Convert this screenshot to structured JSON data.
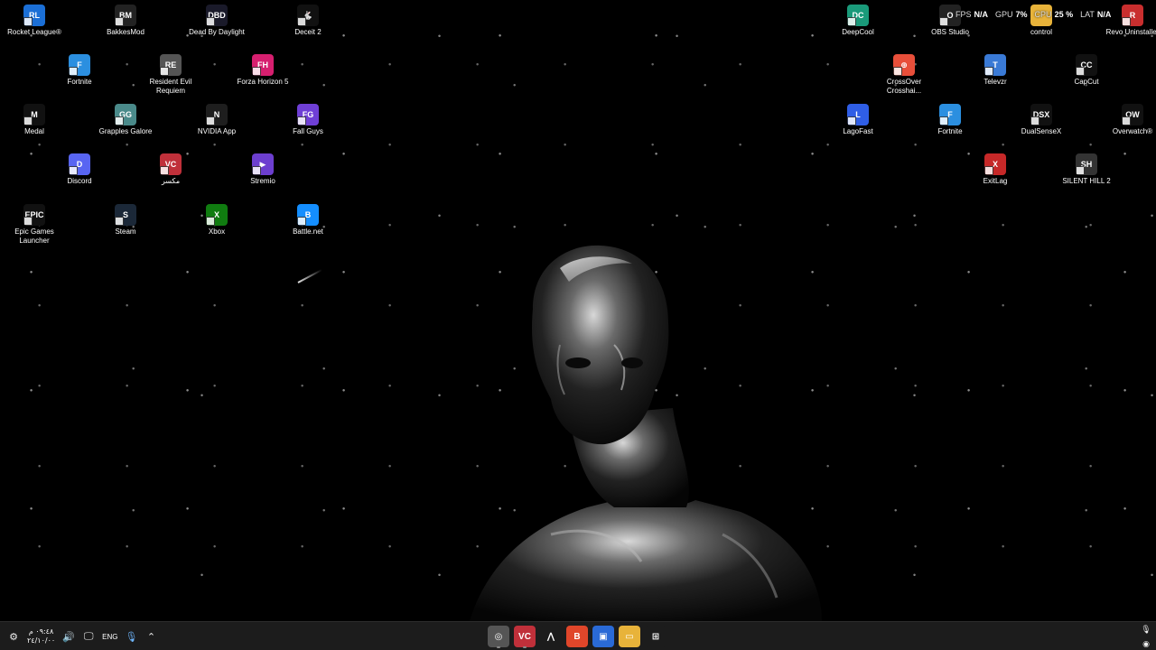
{
  "desktop": {
    "left_icons": [
      {
        "label": "Rocket League®",
        "icon": "rocket-league-icon",
        "color": "#1b6fd6",
        "glyph": "RL"
      },
      {
        "label": "BakkesMod",
        "icon": "bakkesmod-icon",
        "color": "#222222",
        "glyph": "BM"
      },
      {
        "label": "Dead By Daylight",
        "icon": "dead-by-daylight-icon",
        "color": "#1a1a2a",
        "glyph": "DBD"
      },
      {
        "label": "Deceit 2",
        "icon": "deceit-icon",
        "color": "#111111",
        "glyph": "🐇"
      },
      {
        "label": "Fortnite",
        "icon": "fortnite-icon",
        "color": "#2b8fe0",
        "glyph": "F"
      },
      {
        "label": "Resident Evil Requiem",
        "icon": "resident-evil-icon",
        "color": "#555555",
        "glyph": "RE"
      },
      {
        "label": "Forza Horizon 5",
        "icon": "forza-icon",
        "color": "#d61f6f",
        "glyph": "FH"
      },
      {
        "label": "Medal",
        "icon": "medal-icon",
        "color": "#111111",
        "glyph": "M"
      },
      {
        "label": "Grapples Galore",
        "icon": "grapples-galore-icon",
        "color": "#4a8a8a",
        "glyph": "GG"
      },
      {
        "label": "NVIDIA App",
        "icon": "nvidia-icon",
        "color": "#1e1e1e",
        "glyph": "N"
      },
      {
        "label": "Fall Guys",
        "icon": "fall-guys-icon",
        "color": "#6f3fd6",
        "glyph": "FG"
      },
      {
        "label": "Discord",
        "icon": "discord-icon",
        "color": "#5865f2",
        "glyph": "D"
      },
      {
        "label": "مكسر",
        "icon": "voice-changer-icon",
        "color": "#c0303a",
        "glyph": "VC"
      },
      {
        "label": "Stremio",
        "icon": "stremio-icon",
        "color": "#6c3ecf",
        "glyph": "▶"
      },
      {
        "label": "Epic Games Launcher",
        "icon": "epic-games-icon",
        "color": "#111111",
        "glyph": "EPIC"
      },
      {
        "label": "Steam",
        "icon": "steam-icon",
        "color": "#1b2838",
        "glyph": "S"
      },
      {
        "label": "Xbox",
        "icon": "xbox-icon",
        "color": "#107c10",
        "glyph": "X"
      },
      {
        "label": "Battle.net",
        "icon": "battlenet-icon",
        "color": "#148eff",
        "glyph": "B"
      }
    ],
    "right_icons": [
      {
        "label": "DeepCool",
        "icon": "deepcool-icon",
        "color": "#1a9a7a",
        "glyph": "DC"
      },
      {
        "label": "OBS Studio",
        "icon": "obs-icon",
        "color": "#222222",
        "glyph": "O"
      },
      {
        "label": "control",
        "icon": "folder-icon",
        "color": "#e8b33a",
        "glyph": ""
      },
      {
        "label": "Revo Uninstaller",
        "icon": "revo-uninstaller-icon",
        "color": "#c92e2e",
        "glyph": "R"
      },
      {
        "label": "CrossOver Crosshai...",
        "icon": "crossover-icon",
        "color": "#e84f3a",
        "glyph": "⊕"
      },
      {
        "label": "Televzr",
        "icon": "televzr-icon",
        "color": "#3a7ad6",
        "glyph": "T"
      },
      {
        "label": "CapCut",
        "icon": "capcut-icon",
        "color": "#111111",
        "glyph": "CC"
      },
      {
        "label": "LagoFast",
        "icon": "lagofast-icon",
        "color": "#2f5ee6",
        "glyph": "L"
      },
      {
        "label": "Fortnite",
        "icon": "fortnite-icon",
        "color": "#2b8fe0",
        "glyph": "F"
      },
      {
        "label": "DualSenseX",
        "icon": "dualsensex-icon",
        "color": "#111111",
        "glyph": "DSX"
      },
      {
        "label": "Overwatch®",
        "icon": "overwatch-icon",
        "color": "#111111",
        "glyph": "OW"
      },
      {
        "label": "ExitLag",
        "icon": "exitlag-icon",
        "color": "#c62828",
        "glyph": "X"
      },
      {
        "label": "SILENT HILL 2",
        "icon": "silent-hill-icon",
        "color": "#333333",
        "glyph": "SH"
      }
    ]
  },
  "overlay": {
    "fps_label": "FPS",
    "fps_value": "N/A",
    "gpu_label": "GPU",
    "gpu_value": "7%",
    "cpu_label": "CPU",
    "cpu_value": "25 %",
    "lat_label": "LAT",
    "lat_value": "N/A"
  },
  "taskbar": {
    "clock_time": "٠٩:٤٨ م",
    "clock_date": "٢٤/١٠/٠٠",
    "language": "ENG",
    "apps": [
      {
        "icon": "crossover-taskbar-icon",
        "color": "#555555",
        "glyph": "◎"
      },
      {
        "icon": "voice-changer-taskbar-icon",
        "color": "#c0303a",
        "glyph": "VC"
      },
      {
        "icon": "arrow-app-icon",
        "color": "#1c1c1c",
        "glyph": "⋀"
      },
      {
        "icon": "brave-browser-icon",
        "color": "#e0462a",
        "glyph": "B"
      },
      {
        "icon": "microsoft-store-icon",
        "color": "#2a6ad6",
        "glyph": "▣"
      },
      {
        "icon": "file-explorer-icon",
        "color": "#e8b33a",
        "glyph": "▭"
      },
      {
        "icon": "start-icon",
        "color": "#1c1c1c",
        "glyph": "⊞"
      }
    ]
  }
}
